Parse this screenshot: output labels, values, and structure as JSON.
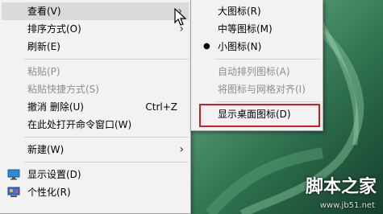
{
  "main_menu": {
    "view": "查看(V)",
    "sort_by": "排序方式(O)",
    "refresh": "刷新(E)",
    "paste": "粘贴(P)",
    "paste_shortcut": "粘贴快捷方式(S)",
    "undo_delete": "撤消 删除(U)",
    "undo_shortcut": "Ctrl+Z",
    "open_cmd": "在此处打开命令窗口(W)",
    "new": "新建(W)",
    "display_settings": "显示设置(D)",
    "personalize": "个性化(R)"
  },
  "view_submenu": {
    "large_icons": "大图标(R)",
    "medium_icons": "中等图标(M)",
    "small_icons": "小图标(N)",
    "auto_arrange": "自动排列图标(A)",
    "align_grid": "将图标与网格对齐(I)",
    "show_desktop_icons": "显示桌面图标(D)"
  },
  "watermark": {
    "text": "脚本之家",
    "url": "www.jb51.net"
  },
  "icons": [
    "chevron-right-icon",
    "bullet-icon",
    "display-icon",
    "personalize-icon",
    "mouse-cursor-icon"
  ],
  "colors": {
    "highlight_box": "#d21e1e",
    "menu_bg": "#f2f2f2",
    "hover_bg": "#dadada"
  }
}
